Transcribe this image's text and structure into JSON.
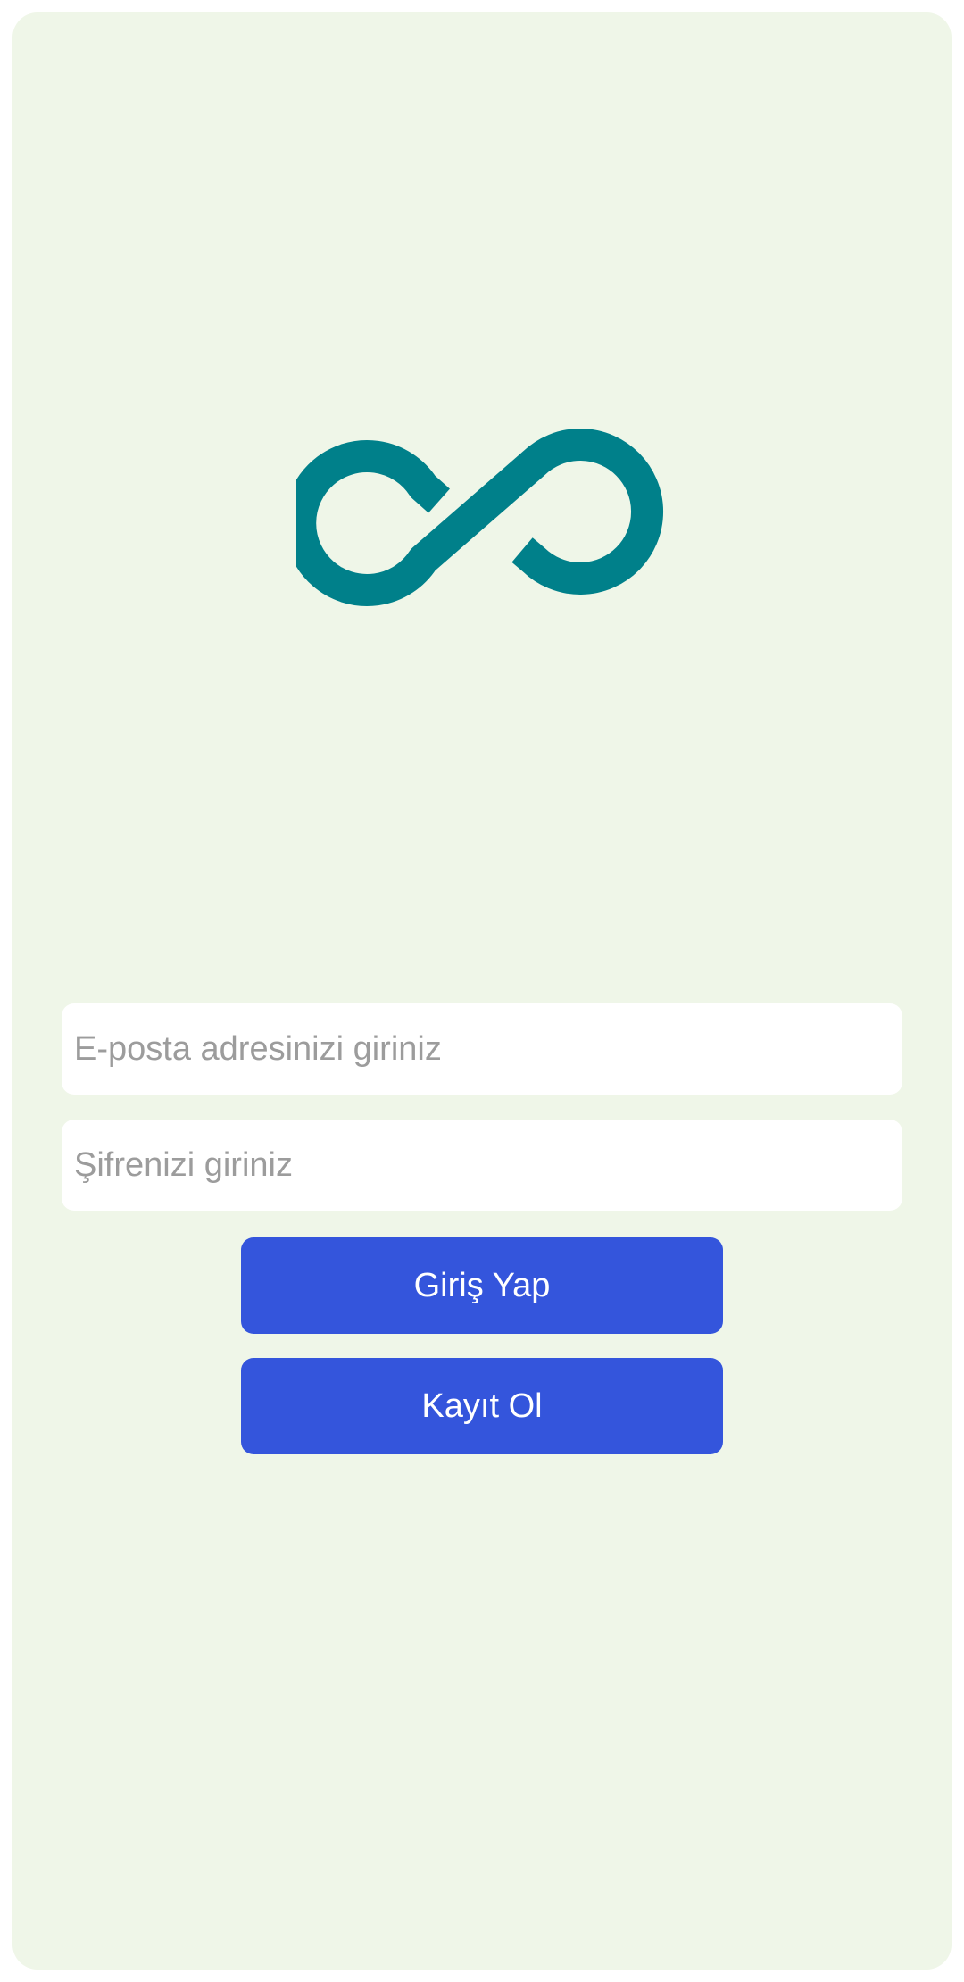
{
  "app": {
    "logo_icon": "infinity-icon",
    "logo_color": "#00808a",
    "background_color": "#eff6e8"
  },
  "form": {
    "email_placeholder": "E-posta adresinizi giriniz",
    "email_value": "",
    "password_placeholder": "Şifrenizi giriniz",
    "password_value": "",
    "login_label": "Giriş Yap",
    "register_label": "Kayıt Ol",
    "button_color": "#3455dc"
  }
}
